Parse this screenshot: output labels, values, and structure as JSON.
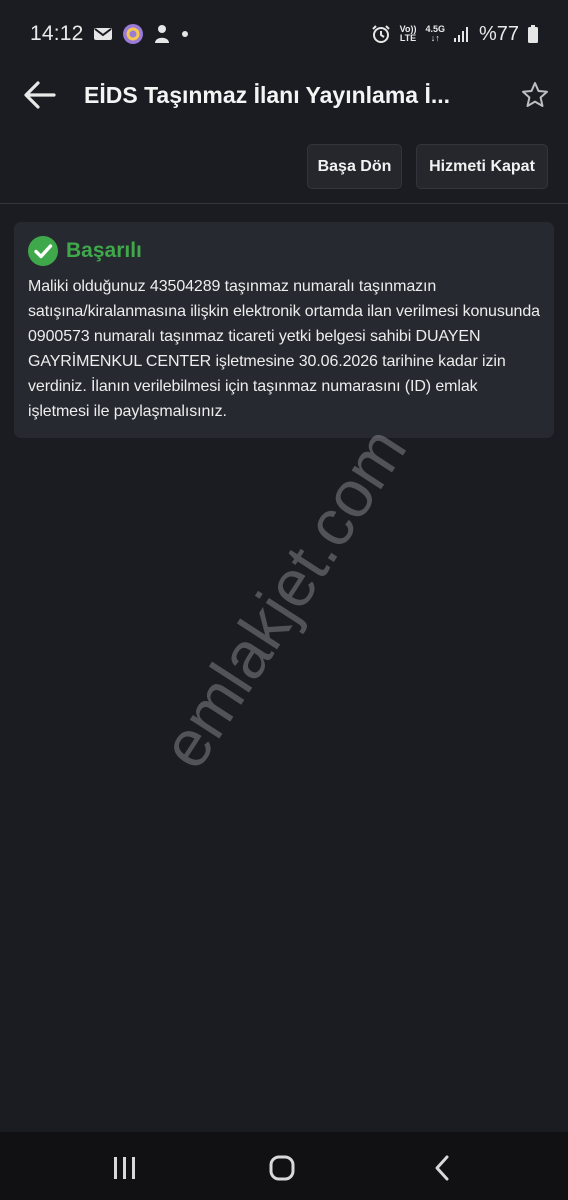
{
  "status_bar": {
    "time": "14:12",
    "network_top": "Vo))",
    "network_bottom": "LTE",
    "signal_top": "4.5G",
    "signal_bottom": "↓↑",
    "battery": "%77"
  },
  "app_bar": {
    "title": "EİDS Taşınmaz İlanı Yayınlama İ..."
  },
  "actions": {
    "back_to_start_label": "Başa Dön",
    "close_service_label": "Hizmeti Kapat"
  },
  "result": {
    "title": "Başarılı",
    "message": "Maliki olduğunuz 43504289 taşınmaz numaralı taşınmazın satışına/kiralanmasına ilişkin elektronik ortamda ilan verilmesi konusunda 0900573 numaralı taşınmaz ticareti yetki belgesi sahibi DUAYEN GAYRİMENKUL CENTER işletmesine 30.06.2026 tarihine kadar izin verdiniz. İlanın verilebilmesi için taşınmaz numarasını (ID) emlak işletmesi ile paylaşmalısınız."
  },
  "watermark": "emlakjet.com",
  "colors": {
    "background": "#1b1c21",
    "card": "#272930",
    "success": "#3fa84a",
    "button": "#26272d"
  }
}
